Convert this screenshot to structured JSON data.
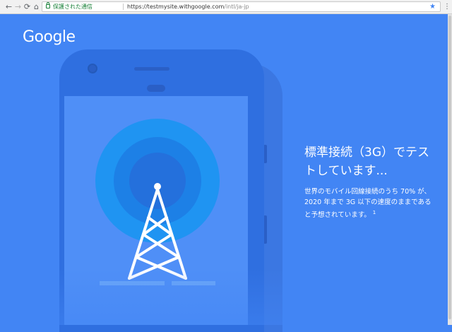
{
  "browser": {
    "secure_label": "保護された通信",
    "url_host": "https://testmysite.withgoogle.com",
    "url_path": "/intl/ja-jp",
    "back_glyph": "←",
    "forward_glyph": "→",
    "reload_glyph": "⟳",
    "home_glyph": "⌂",
    "star_glyph": "★",
    "menu_glyph": "⋮"
  },
  "page": {
    "logo": "Google",
    "headline": "標準接続（3G）でテストしています...",
    "body": "世界のモバイル回線接続のうち 70% が、2020 年まで 3G 以下の速度のままであると予想されています。",
    "footnote": "1"
  },
  "colors": {
    "background": "#4285f4",
    "phone": "#2f6fe0",
    "screen": "#4f8ff7",
    "signal_outer": "#1f94f2",
    "signal_mid": "#1d80e6",
    "signal_inner": "#2470dc",
    "tower": "#ffffff",
    "ground": "#6aa6f8"
  }
}
